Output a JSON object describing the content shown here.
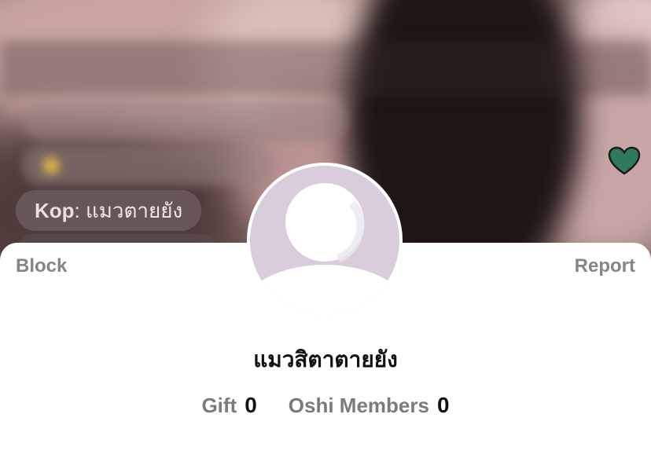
{
  "chat": {
    "comment_user": "Kop",
    "comment_text": ": แมวตายยัง"
  },
  "sheet": {
    "block_label": "Block",
    "report_label": "Report",
    "username": "แมวสิตาตายยัง",
    "stats": [
      {
        "label": "Gift",
        "value": "0"
      },
      {
        "label": "Oshi Members",
        "value": "0"
      }
    ]
  },
  "icons": {
    "heart": "heart-icon",
    "avatar": "default-avatar-icon"
  },
  "colors": {
    "heart_fill": "#2e7a5a",
    "avatar_bg": "#d9ccdb",
    "avatar_figure": "#ffffff"
  }
}
